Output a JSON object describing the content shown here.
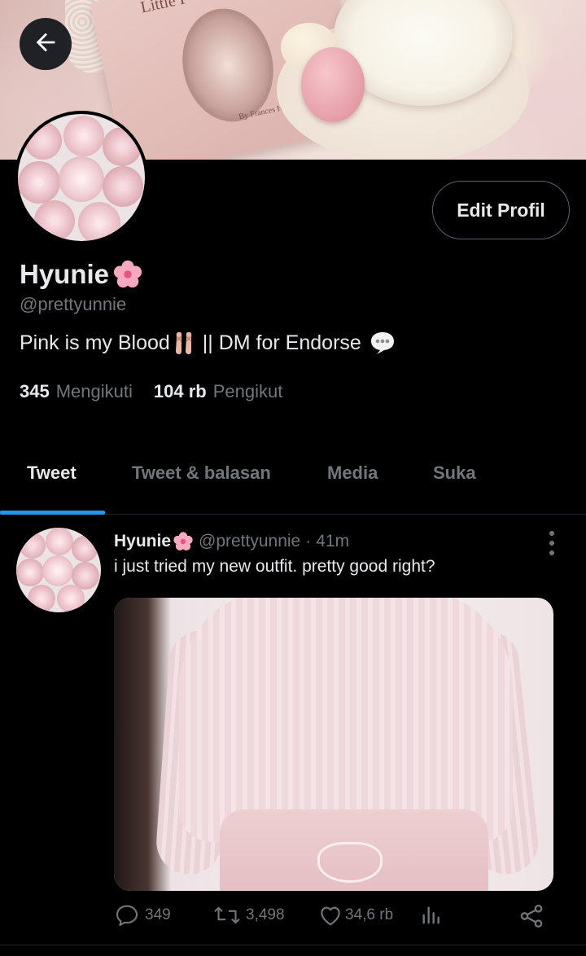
{
  "profile": {
    "name": "Hyunie",
    "handle": "@prettyunnie",
    "bio_part1": "Pink is my Blood",
    "bio_part2": "|| DM for Endorse",
    "edit_button": "Edit Profil",
    "following_count": "345",
    "following_label": "Mengikuti",
    "followers_count": "104 rb",
    "followers_label": "Pengikut",
    "banner_book_title": "Little P",
    "banner_book_author": "By Frances Ho"
  },
  "tabs": [
    {
      "label": "Tweet",
      "active": true
    },
    {
      "label": "Tweet & balasan",
      "active": false
    },
    {
      "label": "Media",
      "active": false
    },
    {
      "label": "Suka",
      "active": false
    }
  ],
  "tweet": {
    "name": "Hyunie",
    "handle": "@prettyunnie",
    "separator": "·",
    "time": "41m",
    "text": "i just tried my new outfit. pretty good right?",
    "replies": "349",
    "retweets": "3,498",
    "likes": "34,6 rb"
  },
  "icons": {
    "back": "arrow-left-icon",
    "flower": "cherry-blossom-icon",
    "shoes": "ballet-shoes-icon",
    "bubble": "speech-bubble-icon",
    "more": "more-vertical-icon",
    "reply": "reply-icon",
    "retweet": "retweet-icon",
    "like": "heart-icon",
    "analytics": "analytics-icon",
    "share": "share-icon"
  },
  "colors": {
    "background": "#000000",
    "text_primary": "#e7e9ea",
    "text_secondary": "#71767b",
    "accent": "#1d9bf0",
    "border": "#536471"
  }
}
